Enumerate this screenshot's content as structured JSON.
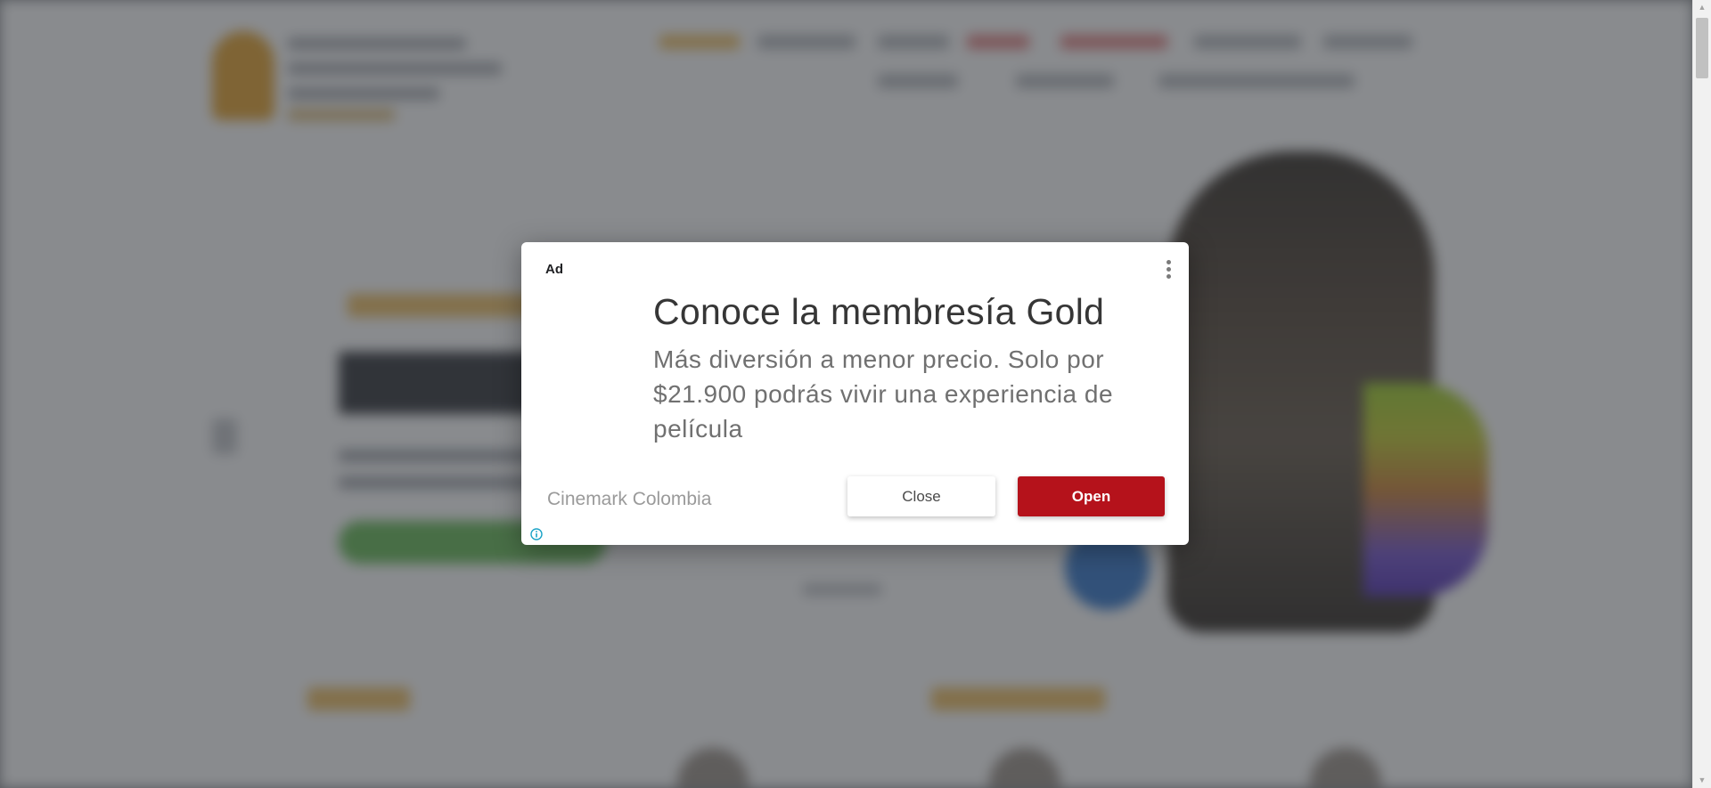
{
  "ad": {
    "label": "Ad",
    "headline": "Conoce la membresía Gold",
    "body": "Más diversión a menor precio. Solo por $21.900 podrás vivir una experiencia de película",
    "advertiser": "Cinemark Colombia",
    "close_label": "Close",
    "open_label": "Open",
    "menu_icon": "more-vert-icon",
    "info_icon": "info-icon",
    "brand_color": "#b5121b",
    "info_color": "#1aa3c7"
  },
  "scrollbar": {
    "up_icon": "scroll-up-arrow-icon",
    "down_icon": "scroll-down-arrow-icon"
  },
  "background": {
    "accent_yellow": "#f0c36b",
    "accent_green": "#6fbf5f"
  }
}
